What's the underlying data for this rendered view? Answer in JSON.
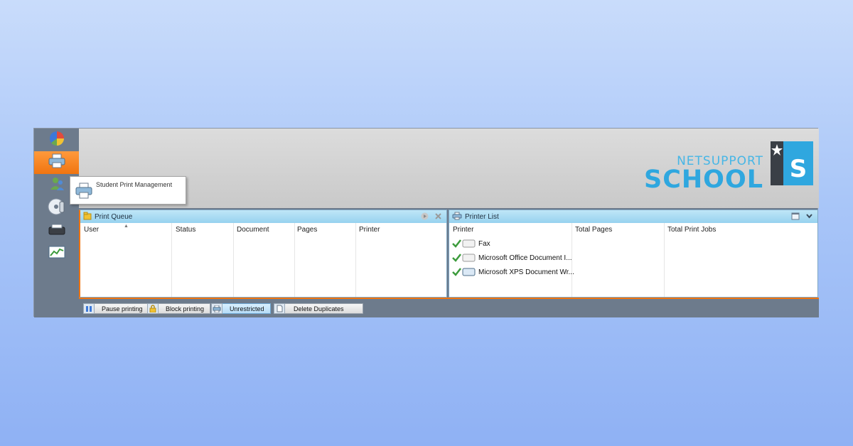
{
  "sidebar": {
    "items": [
      {
        "icon": "pie-chart-icon"
      },
      {
        "icon": "printer-icon",
        "active": true
      },
      {
        "icon": "users-icon"
      },
      {
        "icon": "disc-icon"
      },
      {
        "icon": "scanner-icon"
      },
      {
        "icon": "line-chart-icon"
      }
    ]
  },
  "tooltip": {
    "text": "Student Print Management",
    "icon": "printer-icon"
  },
  "logo": {
    "top": "NETSUPPORT",
    "bottom": "SCHOOL",
    "mark": "S"
  },
  "print_queue": {
    "title": "Print Queue",
    "columns": [
      "User",
      "Status",
      "Document",
      "Pages",
      "Printer"
    ],
    "rows": []
  },
  "printer_list": {
    "title": "Printer List",
    "columns": [
      "Printer",
      "Total Pages",
      "Total Print Jobs"
    ],
    "rows": [
      {
        "name": "Fax",
        "total_pages": "",
        "total_jobs": ""
      },
      {
        "name": "Microsoft Office Document I...",
        "total_pages": "",
        "total_jobs": ""
      },
      {
        "name": "Microsoft XPS Document Wr...",
        "total_pages": "",
        "total_jobs": ""
      }
    ]
  },
  "toolbar": {
    "pause_label": "Pause printing",
    "block_label": "Block printing",
    "unrestricted_label": "Unrestricted",
    "delete_duplicates_label": "Delete Duplicates"
  },
  "colors": {
    "accent": "#f07410",
    "panel_header": "#97d2ef",
    "logo_blue": "#2fa7df",
    "app_frame": "#6d7b8c"
  }
}
